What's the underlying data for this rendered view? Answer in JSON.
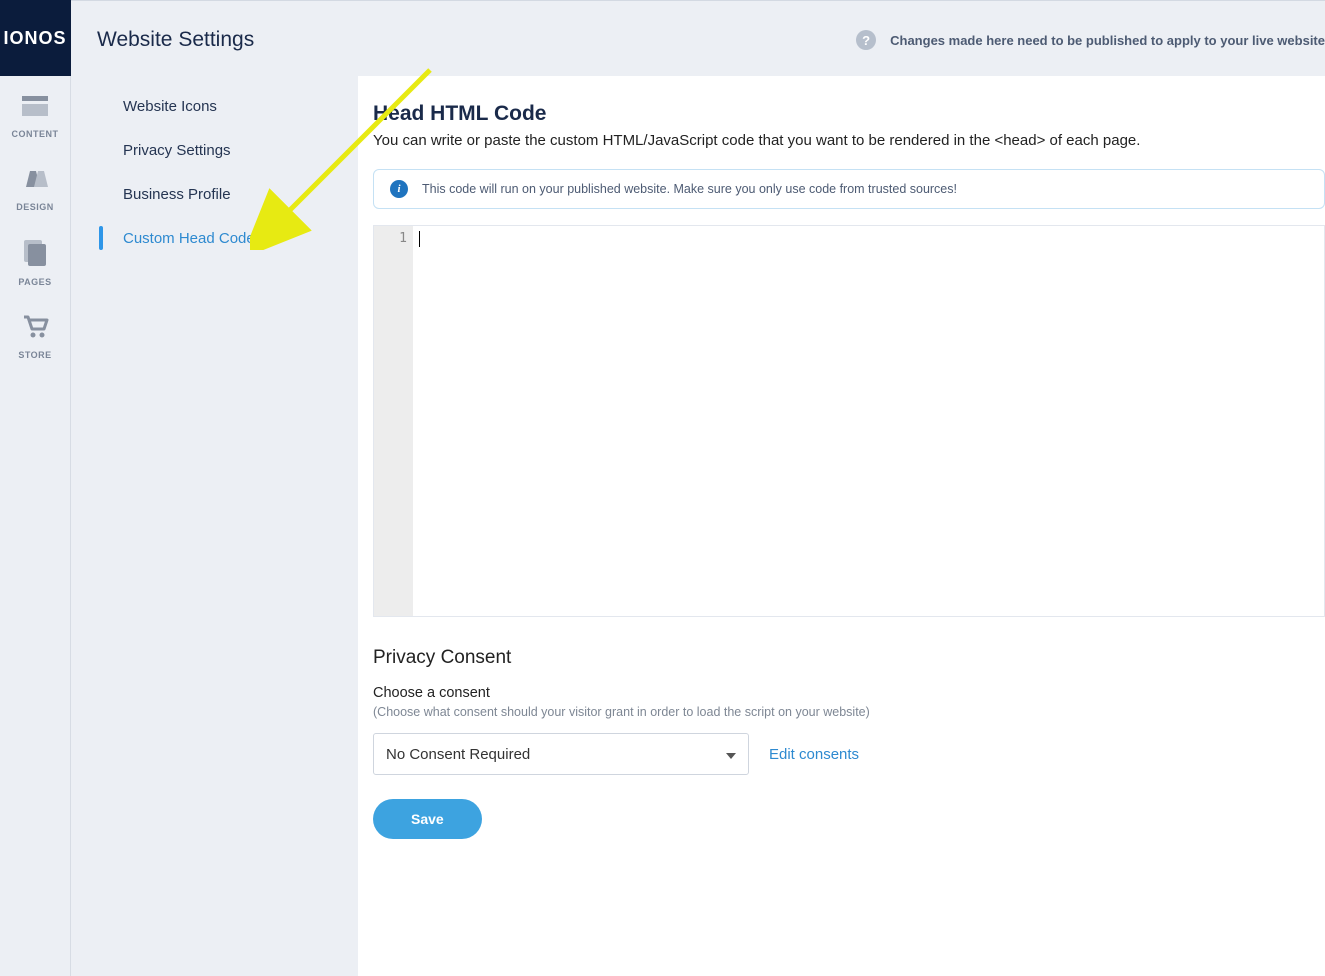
{
  "brand": "IONOS",
  "header": {
    "title": "Website Settings",
    "notice": "Changes made here need to be published to apply to your live website"
  },
  "rail": {
    "items": [
      {
        "id": "content",
        "label": "CONTENT"
      },
      {
        "id": "design",
        "label": "DESIGN"
      },
      {
        "id": "pages",
        "label": "PAGES"
      },
      {
        "id": "store",
        "label": "STORE"
      }
    ]
  },
  "sidebar": {
    "items": [
      {
        "label": "Website Icons",
        "active": false
      },
      {
        "label": "Privacy Settings",
        "active": false
      },
      {
        "label": "Business Profile",
        "active": false
      },
      {
        "label": "Custom Head Code",
        "active": true
      }
    ]
  },
  "main": {
    "title": "Head HTML Code",
    "description": "You can write or paste the custom HTML/JavaScript code that you want to be rendered in the <head> of each page.",
    "info_banner": "This code will run on your published website. Make sure you only use code from trusted sources!",
    "editor": {
      "line_number": "1",
      "content": ""
    },
    "privacy": {
      "title": "Privacy Consent",
      "field_label": "Choose a consent",
      "field_hint": "(Choose what consent should your visitor grant in order to load the script on your website)",
      "select_value": "No Consent Required",
      "edit_link": "Edit consents"
    },
    "save_label": "Save"
  }
}
